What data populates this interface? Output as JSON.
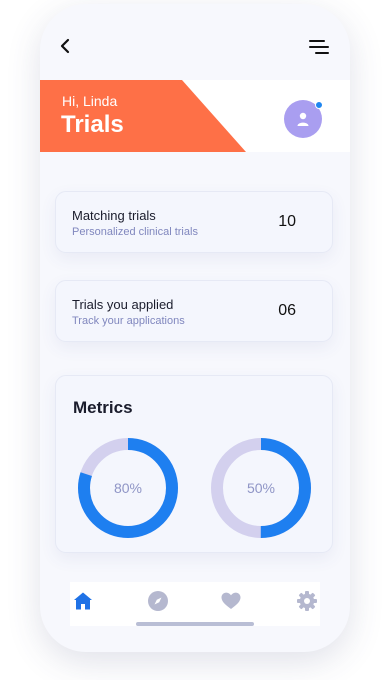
{
  "header": {
    "greeting": "Hi, Linda",
    "title": "Trials",
    "accent_color": "#fe7047"
  },
  "icons": {
    "back": "chevron-left-icon",
    "menu": "menu-icon",
    "avatar": "user-icon",
    "nav": [
      "home-icon",
      "compass-icon",
      "heart-icon",
      "gear-icon"
    ]
  },
  "cards": [
    {
      "title": "Matching trials",
      "subtitle": "Personalized clinical trials",
      "value": "10"
    },
    {
      "title": "Trials you applied",
      "subtitle": "Track your applications",
      "value": "06"
    }
  ],
  "metrics": {
    "title": "Metrics",
    "gauges": [
      {
        "label": "80%",
        "fraction": 0.8,
        "color": "#1e7ff0",
        "track": "#d3d0ee"
      },
      {
        "label": "50%",
        "fraction": 0.5,
        "color": "#1e7ff0",
        "track": "#d3d0ee"
      }
    ]
  },
  "nav": {
    "active_index": 0,
    "active_color": "#1f72e6",
    "inactive_color": "#b5b8cf"
  }
}
